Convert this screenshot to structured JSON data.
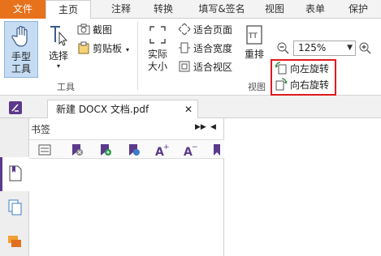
{
  "menu": {
    "tabs": [
      "文件",
      "主页",
      "注释",
      "转换",
      "填写&签名",
      "视图",
      "表单",
      "保护"
    ]
  },
  "ribbon": {
    "hand_tool": "手型\n工具",
    "select": "选择",
    "screenshot": "截图",
    "clipboard": "剪贴板",
    "tools_group": "工具",
    "actual_size": "实际\n大小",
    "fit_page": "适合页面",
    "fit_width": "适合宽度",
    "fit_view": "适合视区",
    "reflow": "重排",
    "zoom_value": "125%",
    "rotate_left": "向左旋转",
    "rotate_right": "向右旋转",
    "view_group": "视图"
  },
  "document": {
    "tab_title": "新建 DOCX 文档.pdf"
  },
  "bookmarks": {
    "title": "书签"
  },
  "colors": {
    "file_tab": "#e8721c",
    "selected": "#c5dcf3",
    "accent_purple": "#5b3a8c",
    "highlight_red": "#e0181c"
  }
}
